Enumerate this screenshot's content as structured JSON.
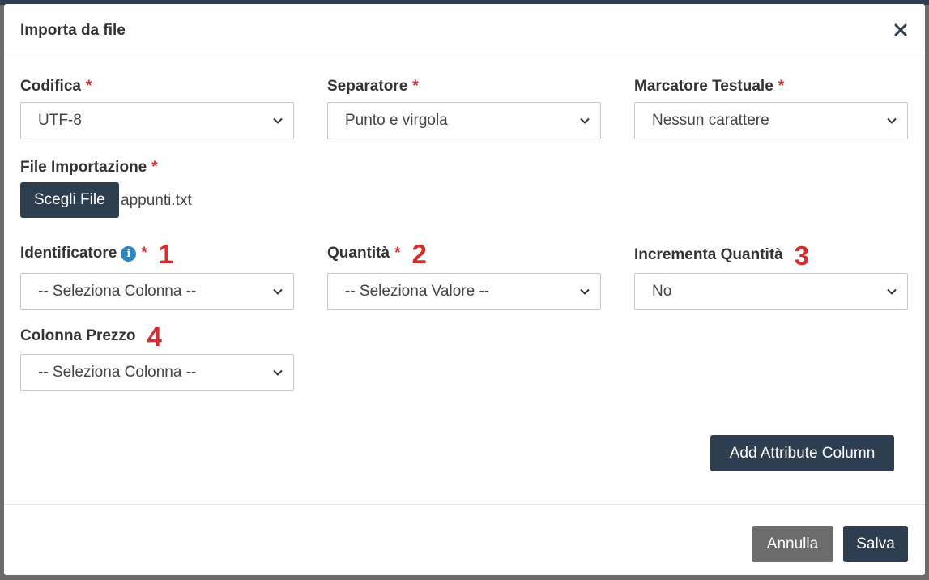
{
  "modal": {
    "title": "Importa da file",
    "close_icon": "close-icon"
  },
  "required_mark": "*",
  "fields": {
    "codifica": {
      "label": "Codifica",
      "value": "UTF-8"
    },
    "separatore": {
      "label": "Separatore",
      "value": "Punto e virgola"
    },
    "marcatore": {
      "label": "Marcatore Testuale",
      "value": "Nessun carattere"
    },
    "file": {
      "label": "File Importazione",
      "button": "Scegli File",
      "filename": "appunti.txt"
    },
    "identificatore": {
      "label": "Identificatore",
      "value": "-- Seleziona Colonna --",
      "annotation": "1"
    },
    "quantita": {
      "label": "Quantità",
      "value": "-- Seleziona Valore --",
      "annotation": "2"
    },
    "incrementa": {
      "label": "Incrementa Quantità",
      "value": "No",
      "annotation": "3"
    },
    "prezzo": {
      "label": "Colonna Prezzo",
      "value": "-- Seleziona Colonna --",
      "annotation": "4"
    }
  },
  "buttons": {
    "add_attribute": "Add Attribute Column",
    "cancel": "Annulla",
    "save": "Salva"
  },
  "colors": {
    "primary": "#2c3e50",
    "secondary": "#6c6c6c",
    "required": "#d63031",
    "annotation": "#d32f2f",
    "info": "#2e86c1"
  }
}
